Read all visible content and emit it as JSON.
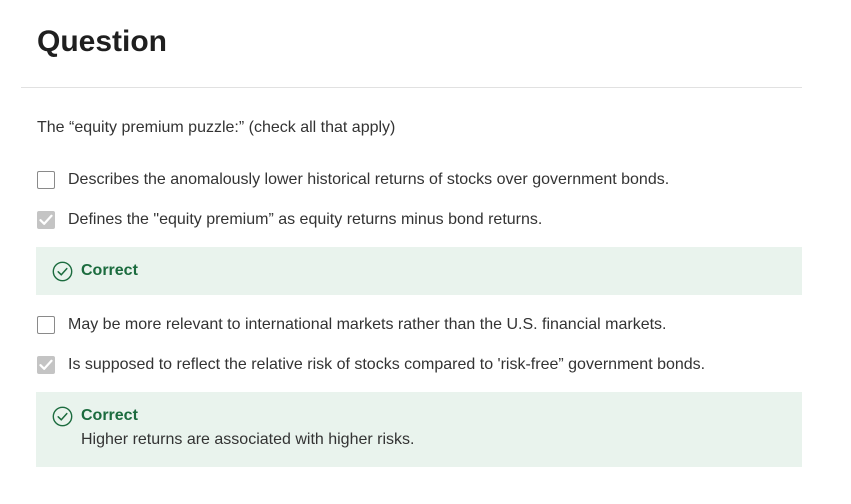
{
  "question": {
    "heading": "Question",
    "prompt": "The “equity premium puzzle:” (check all that apply)"
  },
  "options": [
    {
      "label": "Describes the anomalously lower historical returns of stocks over government bonds.",
      "checked": false
    },
    {
      "label": "Defines the \"equity premium” as equity returns minus bond returns.",
      "checked": true,
      "feedback": {
        "status": "Correct",
        "explanation": ""
      }
    },
    {
      "label": "May be more relevant to international markets rather than the U.S. financial markets.",
      "checked": false
    },
    {
      "label": "Is supposed to reflect the relative risk of stocks compared to 'risk-free” government bonds.",
      "checked": true,
      "feedback": {
        "status": "Correct",
        "explanation": "Higher returns are associated with higher risks."
      }
    }
  ],
  "icons": {
    "checkmark": "check-icon",
    "correct": "check-circle-icon"
  },
  "colors": {
    "correct_text": "#1b6b3e",
    "feedback_background": "#e9f3ed",
    "checked_box": "#c4c4c4"
  }
}
